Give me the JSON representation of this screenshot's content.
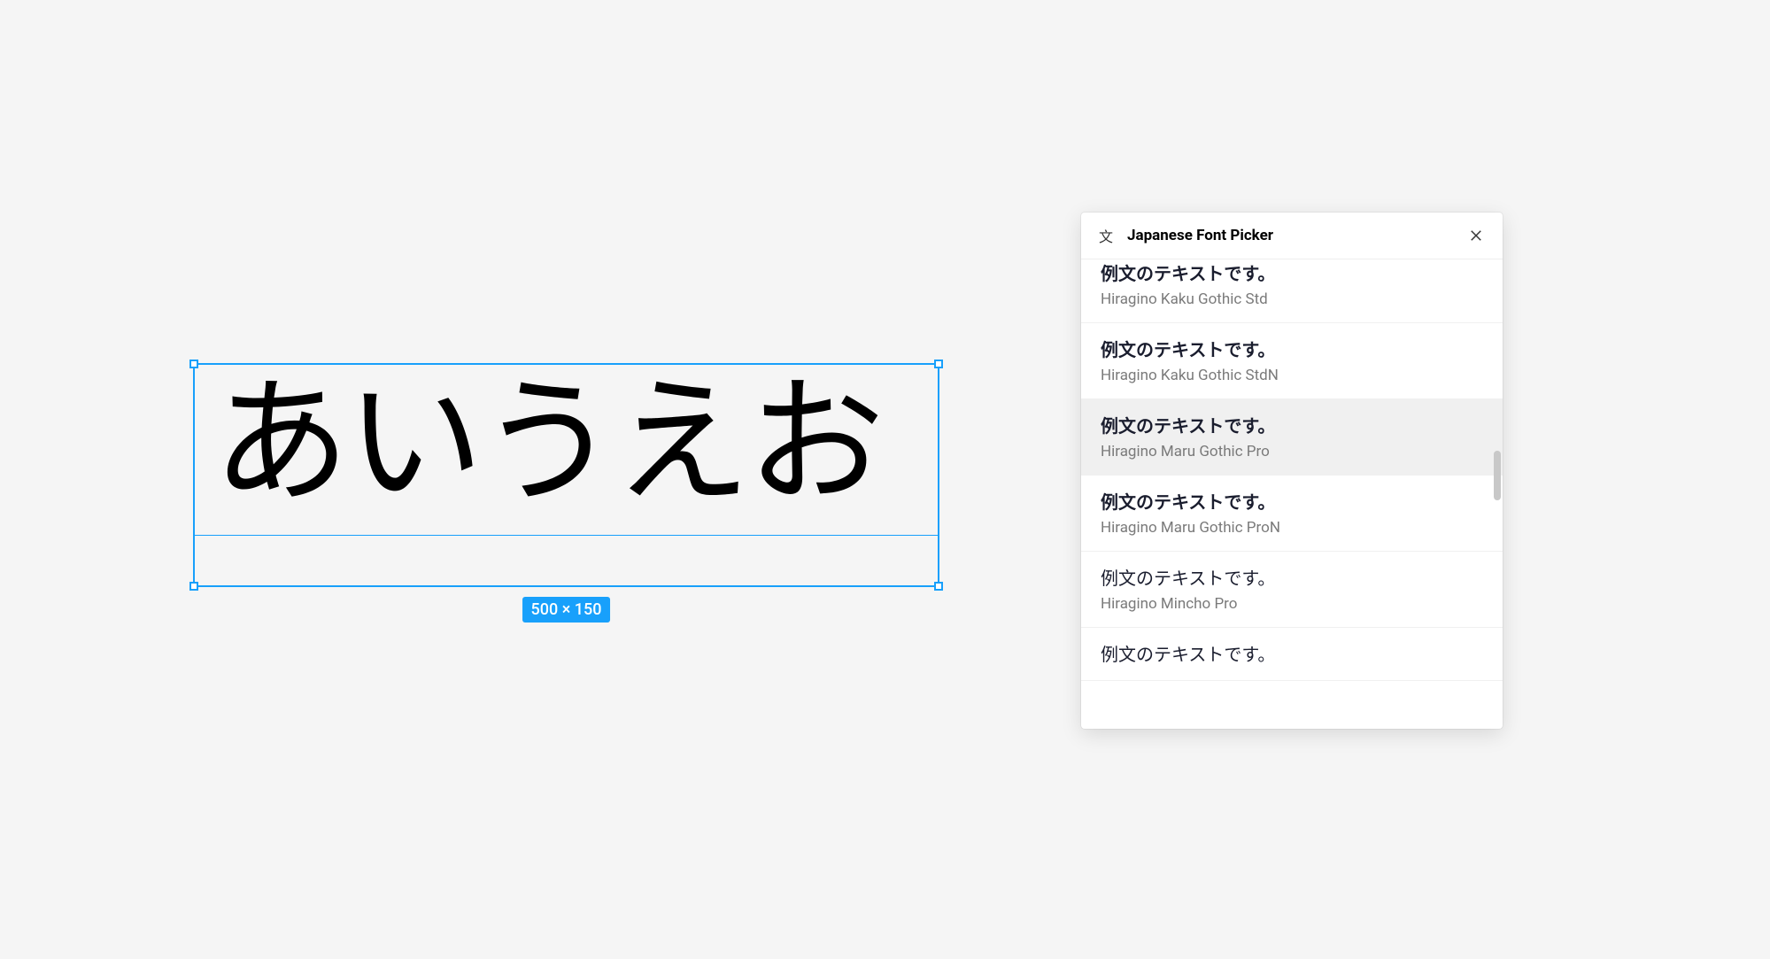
{
  "canvas": {
    "text": "あいうえお",
    "size_label": "500 × 150"
  },
  "panel": {
    "title": "Japanese Font Picker",
    "sample_text": "例文のテキストです。",
    "fonts": [
      {
        "name": "Hiragino Kaku Gothic Std",
        "style": "gothic",
        "selected": false
      },
      {
        "name": "Hiragino Kaku Gothic StdN",
        "style": "gothic",
        "selected": false
      },
      {
        "name": "Hiragino Maru Gothic Pro",
        "style": "maru",
        "selected": true
      },
      {
        "name": "Hiragino Maru Gothic ProN",
        "style": "maru",
        "selected": false
      },
      {
        "name": "Hiragino Mincho Pro",
        "style": "mincho",
        "selected": false
      },
      {
        "name": "",
        "style": "mincho",
        "selected": false,
        "partial": true
      }
    ]
  }
}
